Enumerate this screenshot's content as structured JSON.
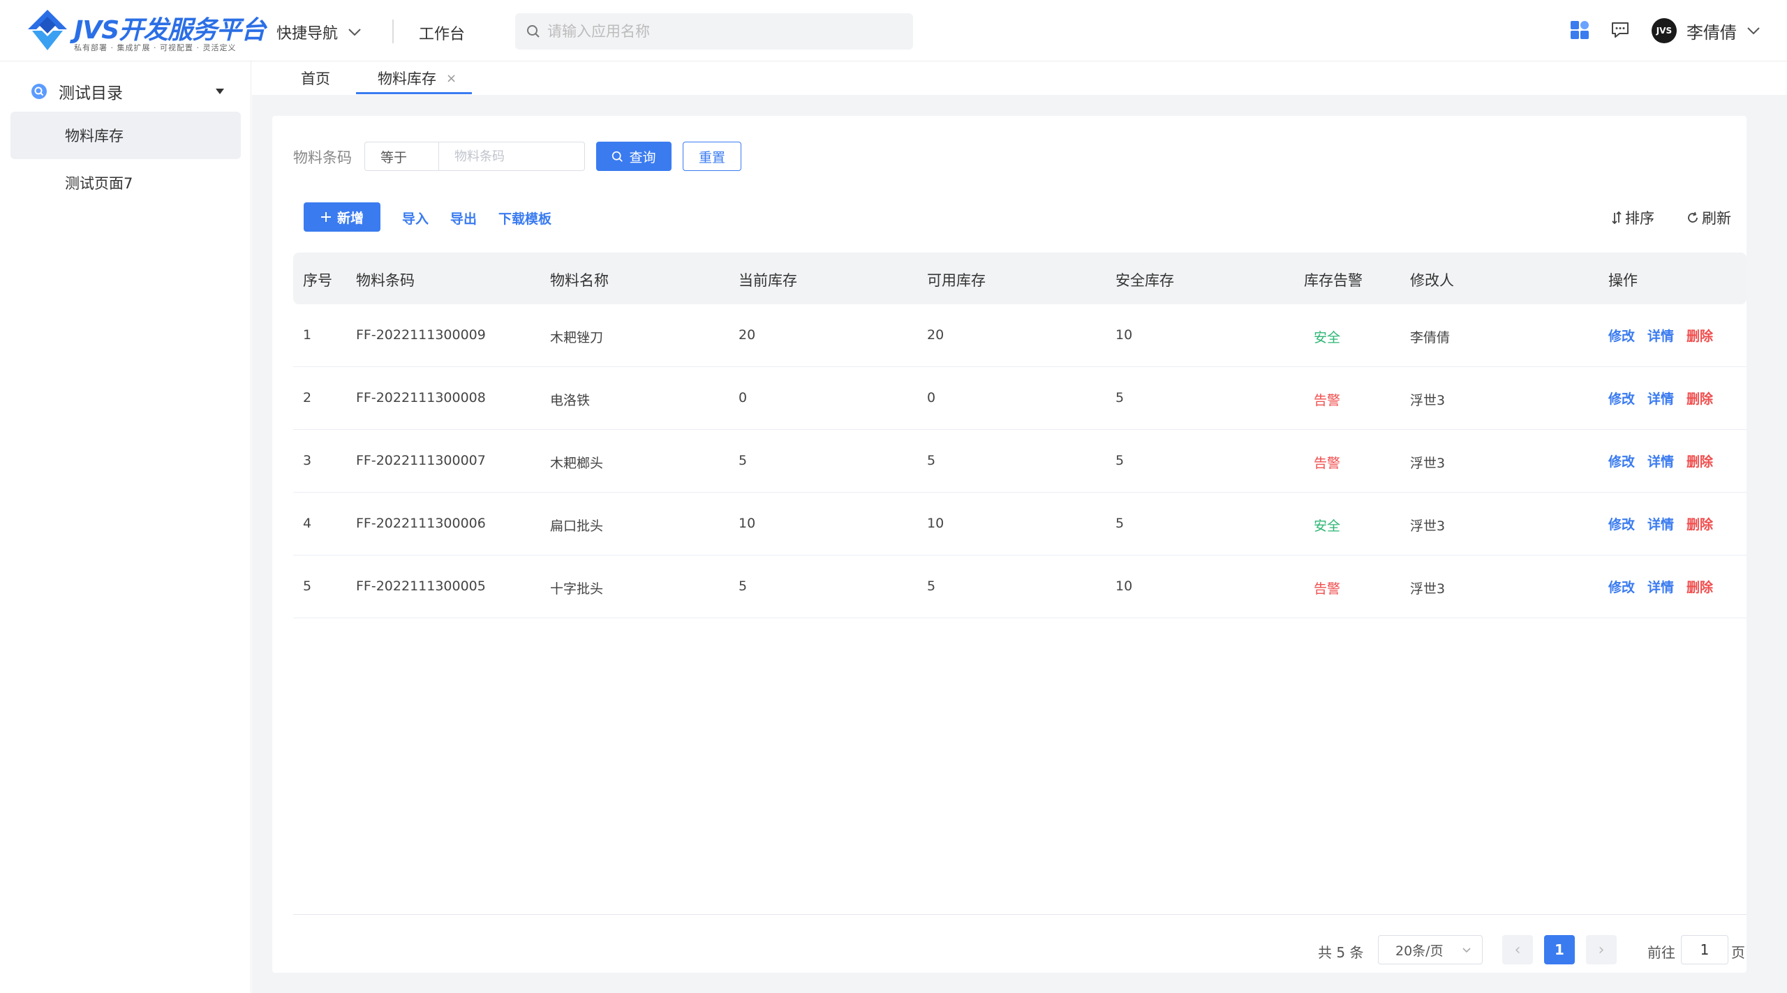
{
  "header": {
    "logo_title": "JVS开发服务平台",
    "logo_subtitle": "私有部署 · 集成扩展 · 可视配置 · 灵活定义",
    "quick_nav": "快捷导航",
    "workbench": "工作台",
    "search_placeholder": "请输入应用名称",
    "avatar_text": "JVS",
    "user_name": "李倩倩",
    "accent_color": "#3a7bf0"
  },
  "sidebar": {
    "group_label": "测试目录",
    "items": [
      {
        "label": "物料库存",
        "active": true
      },
      {
        "label": "测试页面7",
        "active": false
      }
    ]
  },
  "tabs": [
    {
      "label": "首页",
      "active": false
    },
    {
      "label": "物料库存",
      "active": true,
      "closable": true
    }
  ],
  "filter": {
    "label": "物料条码",
    "operator": "等于",
    "placeholder": "物料条码",
    "query_button": "查询",
    "reset_button": "重置"
  },
  "toolbar": {
    "add_button": "新增",
    "import": "导入",
    "export": "导出",
    "download_template": "下载模板",
    "sort": "排序",
    "refresh": "刷新"
  },
  "table": {
    "columns": [
      "序号",
      "物料条码",
      "物料名称",
      "当前库存",
      "可用库存",
      "安全库存",
      "库存告警",
      "修改人",
      "操作"
    ],
    "rows": [
      {
        "index": "1",
        "code": "FF-2022111300009",
        "name": "木耙锉刀",
        "current": "20",
        "available": "20",
        "safe": "10",
        "alert": "安全",
        "alert_type": "safe",
        "modifier": "李倩倩"
      },
      {
        "index": "2",
        "code": "FF-2022111300008",
        "name": "电洛铁",
        "current": "0",
        "available": "0",
        "safe": "5",
        "alert": "告警",
        "alert_type": "warn",
        "modifier": "浮世3"
      },
      {
        "index": "3",
        "code": "FF-2022111300007",
        "name": "木耙榔头",
        "current": "5",
        "available": "5",
        "safe": "5",
        "alert": "告警",
        "alert_type": "warn",
        "modifier": "浮世3"
      },
      {
        "index": "4",
        "code": "FF-2022111300006",
        "name": "扁口批头",
        "current": "10",
        "available": "10",
        "safe": "5",
        "alert": "安全",
        "alert_type": "safe",
        "modifier": "浮世3"
      },
      {
        "index": "5",
        "code": "FF-2022111300005",
        "name": "十字批头",
        "current": "5",
        "available": "5",
        "safe": "10",
        "alert": "告警",
        "alert_type": "warn",
        "modifier": "浮世3"
      }
    ],
    "actions": {
      "edit": "修改",
      "detail": "详情",
      "delete": "删除"
    },
    "status_colors": {
      "safe": "#2bb673",
      "warn": "#f04e4e"
    }
  },
  "pagination": {
    "total": "共 5 条",
    "page_size": "20条/页",
    "prev": "‹",
    "next": "›",
    "current_page": "1",
    "goto_label": "前往",
    "goto_value": "1",
    "page_suffix": "页"
  }
}
